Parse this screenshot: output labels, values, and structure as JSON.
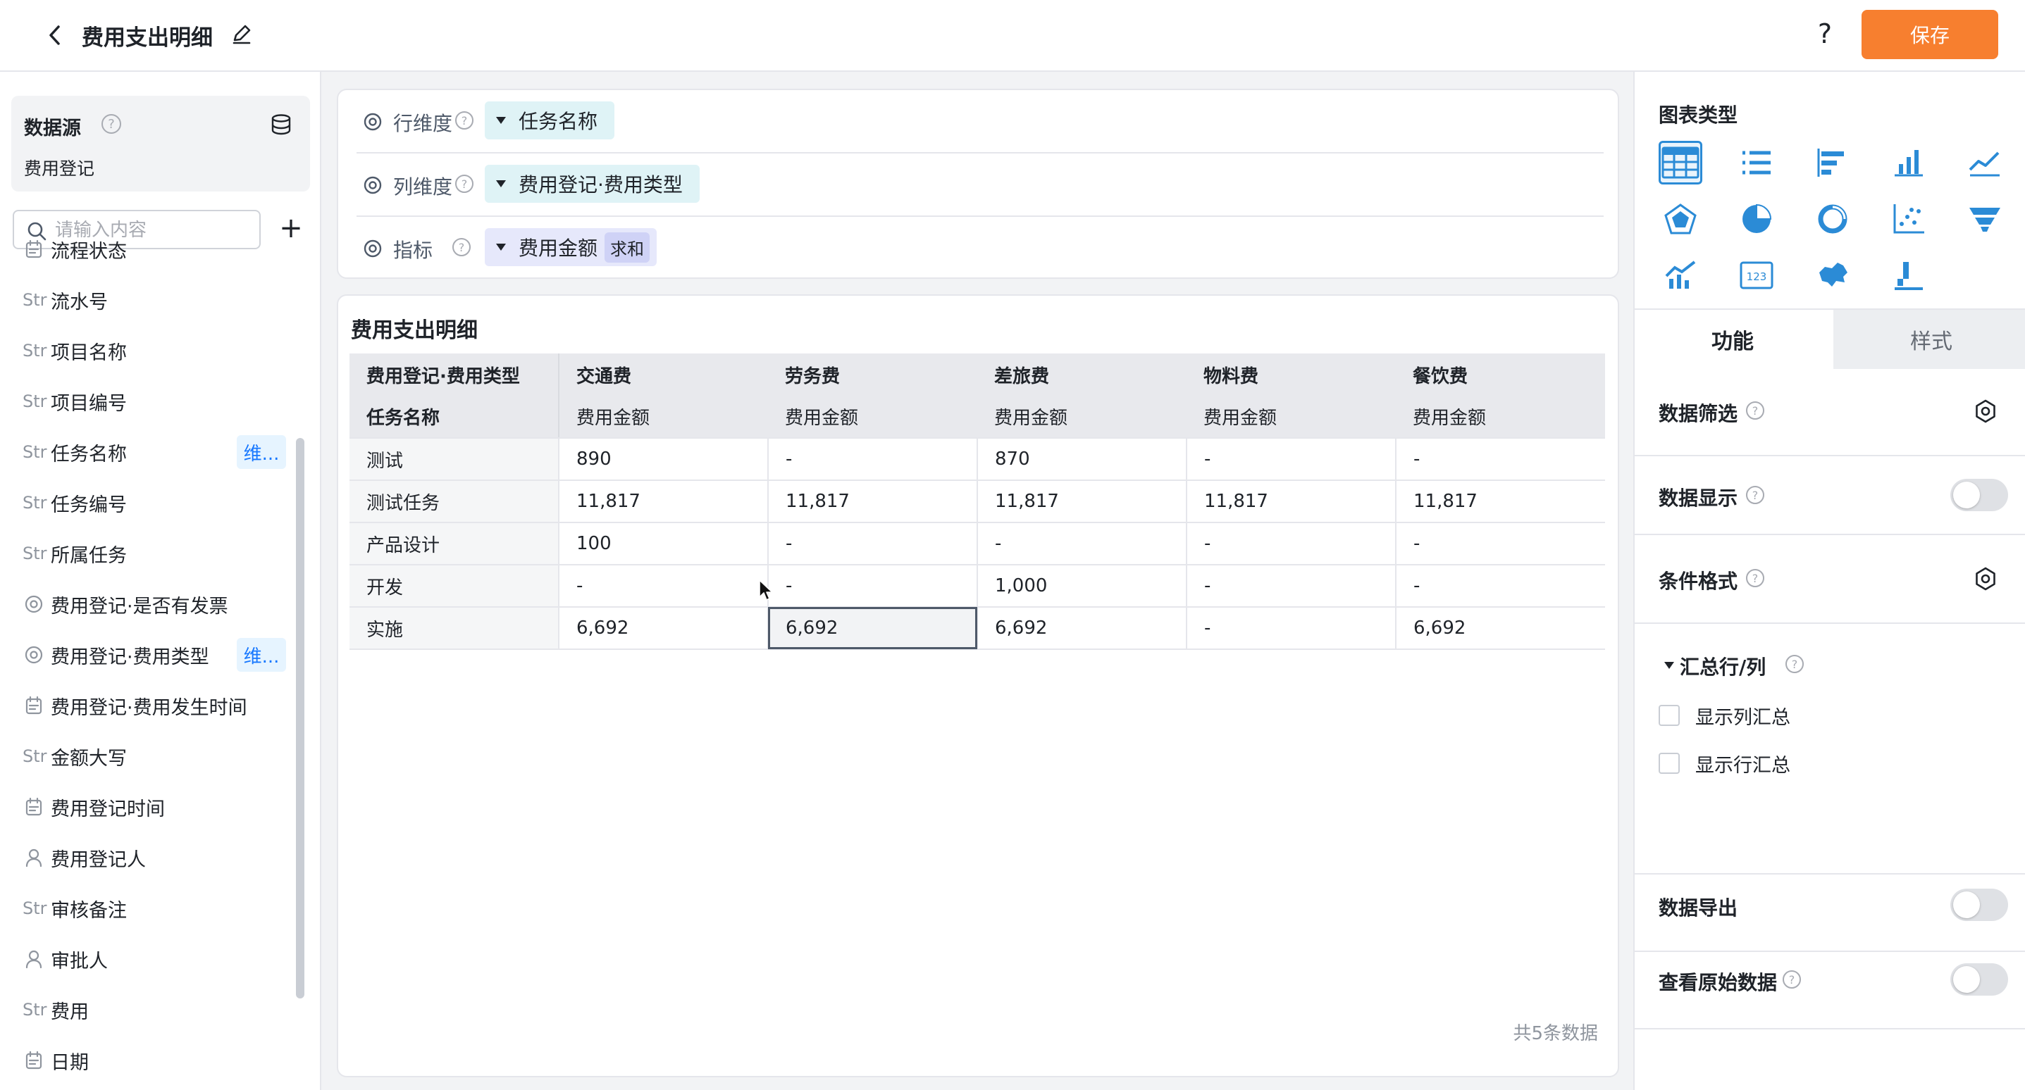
{
  "header": {
    "title": "费用支出明细",
    "help_label": "?",
    "save_label": "保存"
  },
  "datasource": {
    "title": "数据源",
    "help_label": "?",
    "name": "费用登记",
    "search_placeholder": "请输入内容",
    "add_label": "+",
    "fields": [
      {
        "type": "date",
        "label": "流程状态",
        "tag": ""
      },
      {
        "type": "Str",
        "label": "流水号",
        "tag": ""
      },
      {
        "type": "Str",
        "label": "项目名称",
        "tag": ""
      },
      {
        "type": "Str",
        "label": "项目编号",
        "tag": ""
      },
      {
        "type": "Str",
        "label": "任务名称",
        "tag": "维..."
      },
      {
        "type": "Str",
        "label": "任务编号",
        "tag": ""
      },
      {
        "type": "Str",
        "label": "所属任务",
        "tag": ""
      },
      {
        "type": "option",
        "label": "费用登记·是否有发票",
        "tag": ""
      },
      {
        "type": "option",
        "label": "费用登记·费用类型",
        "tag": "维..."
      },
      {
        "type": "date",
        "label": "费用登记·费用发生时间",
        "tag": ""
      },
      {
        "type": "Str",
        "label": "金额大写",
        "tag": ""
      },
      {
        "type": "date",
        "label": "费用登记时间",
        "tag": ""
      },
      {
        "type": "user",
        "label": "费用登记人",
        "tag": ""
      },
      {
        "type": "Str",
        "label": "审核备注",
        "tag": ""
      },
      {
        "type": "user",
        "label": "审批人",
        "tag": ""
      },
      {
        "type": "Str",
        "label": "费用",
        "tag": ""
      },
      {
        "type": "date",
        "label": "日期",
        "tag": ""
      }
    ]
  },
  "config": {
    "row_dim": {
      "label": "行维度",
      "help": "?",
      "chip": "任务名称"
    },
    "col_dim": {
      "label": "列维度",
      "help": "?",
      "chip": "费用登记·费用类型"
    },
    "metric": {
      "label": "指标",
      "help": "?",
      "chip": "费用金额",
      "agg": "求和"
    }
  },
  "table": {
    "title": "费用支出明细",
    "header_row1": [
      "费用登记·费用类型",
      "交通费",
      "劳务费",
      "差旅费",
      "物料费",
      "餐饮费"
    ],
    "header_row2": [
      "任务名称",
      "费用金额",
      "费用金额",
      "费用金额",
      "费用金额",
      "费用金额"
    ],
    "rows": [
      [
        "测试",
        "890",
        "-",
        "870",
        "-",
        "-"
      ],
      [
        "测试任务",
        "11,817",
        "11,817",
        "11,817",
        "11,817",
        "11,817"
      ],
      [
        "产品设计",
        "100",
        "-",
        "-",
        "-",
        "-"
      ],
      [
        "开发",
        "-",
        "-",
        "1,000",
        "-",
        "-"
      ],
      [
        "实施",
        "6,692",
        "6,692",
        "6,692",
        "-",
        "6,692"
      ]
    ],
    "footer": "共5条数据"
  },
  "right_panel": {
    "chart_type_title": "图表类型",
    "chart_types": [
      "table-icon",
      "list-icon",
      "bar-horizontal-icon",
      "bar-vertical-icon",
      "line-icon",
      "radar-icon",
      "pie-icon",
      "donut-icon",
      "scatter-icon",
      "funnel-icon",
      "combo-icon",
      "number-card-icon",
      "map-icon",
      "gantt-icon"
    ],
    "tabs": [
      "功能",
      "样式"
    ],
    "sections": {
      "filter": "数据筛选",
      "display": "数据显示",
      "conditional": "条件格式",
      "summary": "汇总行/列",
      "show_col_total": "显示列汇总",
      "show_row_total": "显示行汇总",
      "export": "数据导出",
      "raw": "查看原始数据"
    },
    "help_label": "?",
    "accent": "#2b8bd6"
  },
  "colors": {
    "primary_button": "#f77f2f",
    "tag_bg": "#e6f4ff",
    "chip_dim": "#dff3f6",
    "chip_metric": "#e6e8fb"
  }
}
